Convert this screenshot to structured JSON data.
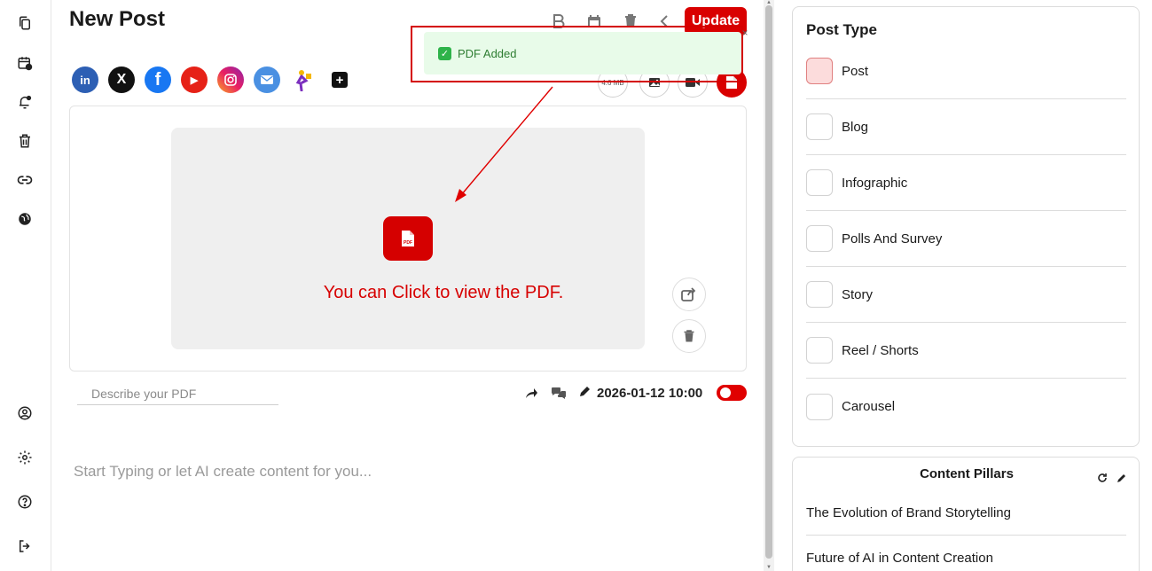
{
  "app": {
    "page_title": "New Post",
    "update_label": "Update"
  },
  "rail": {
    "items": [
      {
        "icon": "copy-icon"
      },
      {
        "icon": "calendar-clock-icon"
      },
      {
        "icon": "bell-icon"
      },
      {
        "icon": "trash-icon"
      },
      {
        "icon": "link-icon"
      },
      {
        "icon": "globe-icon"
      },
      {
        "icon": "user-circle-icon"
      },
      {
        "icon": "gear-icon"
      },
      {
        "icon": "help-icon"
      },
      {
        "icon": "logout-icon"
      }
    ]
  },
  "toolbar": {
    "icons": [
      "bold-icon",
      "calendar-icon",
      "trash-icon",
      "chevron-left-icon"
    ]
  },
  "social": {
    "linkedin": "in",
    "x": "X",
    "facebook": "f",
    "youtube": "▶",
    "add": "+"
  },
  "media": {
    "size_label": "4.6 MB"
  },
  "toast": {
    "message": "PDF Added",
    "close": "×",
    "check": "✓"
  },
  "pdf": {
    "view_text": "You can Click to view the PDF.",
    "icon_label": "PDF"
  },
  "describe": {
    "placeholder": "Describe your PDF"
  },
  "meta": {
    "datetime": "2026-01-12 10:00"
  },
  "content": {
    "placeholder": "Start Typing or let AI create content for you..."
  },
  "post_type": {
    "title": "Post Type",
    "options": [
      {
        "label": "Post",
        "selected": true
      },
      {
        "label": "Blog",
        "selected": false
      },
      {
        "label": "Infographic",
        "selected": false
      },
      {
        "label": "Polls And Survey",
        "selected": false
      },
      {
        "label": "Story",
        "selected": false
      },
      {
        "label": "Reel / Shorts",
        "selected": false
      },
      {
        "label": "Carousel",
        "selected": false
      }
    ]
  },
  "pillars": {
    "title": "Content Pillars",
    "items": [
      "The Evolution of Brand Storytelling",
      "Future of AI in Content Creation"
    ]
  },
  "colors": {
    "accent": "#d90000",
    "toast_bg": "#e8fbe9",
    "selected_bg": "#fcdcdc"
  }
}
